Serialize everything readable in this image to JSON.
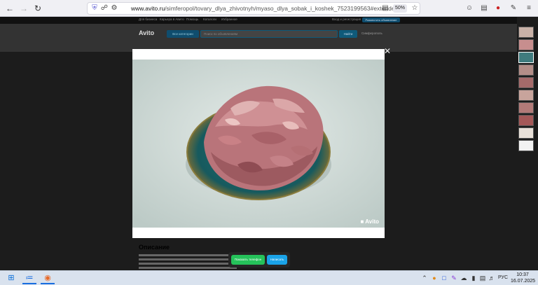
{
  "browser": {
    "url_host": "www.avito.ru",
    "url_path": "/simferopol/tovary_dlya_zhivotnyh/myaso_dlya_sobak_i_koshek_7523199563#extended",
    "zoom": "50%",
    "notification_count": "8"
  },
  "site": {
    "topline_links": [
      "Для бизнеса",
      "Карьера в Авито",
      "Помощь",
      "Каталоги",
      "Избранное"
    ],
    "top_right_login": "Вход и регистрация",
    "post_ad_label": "Разместить объявление",
    "logo": "Avito",
    "categories_label": "Все категории",
    "search_placeholder": "Поиск по объявлениям",
    "search_button": "Найти",
    "region": "Симферополь"
  },
  "listing": {
    "description_title": "Описание",
    "show_phone_label": "Показать телефон",
    "write_label": "Написать"
  },
  "gallery": {
    "watermark": "Avito",
    "close_icon": "close-icon",
    "thumb_count": 10,
    "active_thumb": 2
  },
  "taskbar": {
    "language": "РУС",
    "time": "10:37",
    "date": "16.07.2025"
  },
  "colors": {
    "phone_button": "#25c25a",
    "write_button": "#1aa3e8",
    "overlay": "#1c1c1c"
  }
}
